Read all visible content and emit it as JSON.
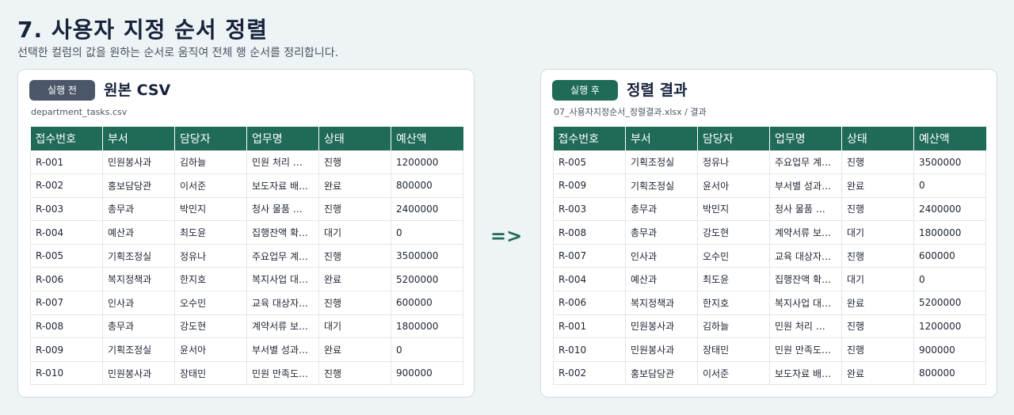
{
  "header": {
    "title": "7. 사용자 지정 순서 정렬",
    "subtitle": "선택한 컬럼의 값을 원하는 순서로 움직여 전체 행 순서를 정리합니다."
  },
  "arrow": "=>",
  "columns": [
    "접수번호",
    "부서",
    "담당자",
    "업무명",
    "상태",
    "예산액"
  ],
  "before": {
    "badge": "실행 전",
    "title": "원본 CSV",
    "filename": "department_tasks.csv",
    "rows": [
      [
        "R-001",
        "민원봉사과",
        "김하늘",
        "민원 처리 …",
        "진행",
        "1200000"
      ],
      [
        "R-002",
        "홍보담당관",
        "이서준",
        "보도자료 배…",
        "완료",
        "800000"
      ],
      [
        "R-003",
        "총무과",
        "박민지",
        "청사 물품 …",
        "진행",
        "2400000"
      ],
      [
        "R-004",
        "예산과",
        "최도윤",
        "집행잔액 확…",
        "대기",
        "0"
      ],
      [
        "R-005",
        "기획조정실",
        "정유나",
        "주요업무 계…",
        "진행",
        "3500000"
      ],
      [
        "R-006",
        "복지정책과",
        "한지호",
        "복지사업 대…",
        "완료",
        "5200000"
      ],
      [
        "R-007",
        "인사과",
        "오수민",
        "교육 대상자…",
        "진행",
        "600000"
      ],
      [
        "R-008",
        "총무과",
        "강도현",
        "계약서류 보…",
        "대기",
        "1800000"
      ],
      [
        "R-009",
        "기획조정실",
        "윤서아",
        "부서별 성과…",
        "완료",
        "0"
      ],
      [
        "R-010",
        "민원봉사과",
        "장태민",
        "민원 만족도…",
        "진행",
        "900000"
      ]
    ]
  },
  "after": {
    "badge": "실행 후",
    "title": "정렬 결과",
    "filename": "07_사용자지정순서_정렬결과.xlsx / 결과",
    "rows": [
      [
        "R-005",
        "기획조정실",
        "정유나",
        "주요업무 계…",
        "진행",
        "3500000"
      ],
      [
        "R-009",
        "기획조정실",
        "윤서아",
        "부서별 성과…",
        "완료",
        "0"
      ],
      [
        "R-003",
        "총무과",
        "박민지",
        "청사 물품 …",
        "진행",
        "2400000"
      ],
      [
        "R-008",
        "총무과",
        "강도현",
        "계약서류 보…",
        "대기",
        "1800000"
      ],
      [
        "R-007",
        "인사과",
        "오수민",
        "교육 대상자…",
        "진행",
        "600000"
      ],
      [
        "R-004",
        "예산과",
        "최도윤",
        "집행잔액 확…",
        "대기",
        "0"
      ],
      [
        "R-006",
        "복지정책과",
        "한지호",
        "복지사업 대…",
        "완료",
        "5200000"
      ],
      [
        "R-001",
        "민원봉사과",
        "김하늘",
        "민원 처리 …",
        "진행",
        "1200000"
      ],
      [
        "R-010",
        "민원봉사과",
        "장태민",
        "민원 만족도…",
        "진행",
        "900000"
      ],
      [
        "R-002",
        "홍보담당관",
        "이서준",
        "보도자료 배…",
        "완료",
        "800000"
      ]
    ]
  }
}
